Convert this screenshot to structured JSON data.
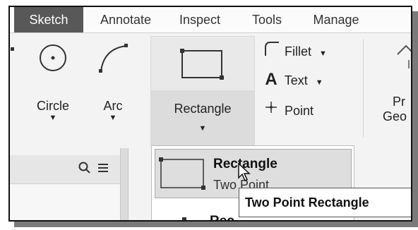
{
  "tabs": [
    {
      "label": "Sketch",
      "active": true
    },
    {
      "label": "Annotate",
      "active": false
    },
    {
      "label": "Inspect",
      "active": false
    },
    {
      "label": "Tools",
      "active": false
    },
    {
      "label": "Manage",
      "active": false
    }
  ],
  "ribbon": {
    "circle_label": "Circle",
    "arc_label": "Arc",
    "rectangle_label": "Rectangle",
    "fillet_label": "Fillet",
    "text_label": "Text",
    "point_label": "Point",
    "project_label": "Pr",
    "geometry_label": "Geo"
  },
  "panel": {
    "search_icon": "search-icon",
    "menu_icon": "menu-icon"
  },
  "dropdown": {
    "item1_title": "Rectangle",
    "item1_subtitle": "Two Point",
    "item2_title": "Rec"
  },
  "tooltip": "Two Point Rectangle",
  "colors": {
    "active_tab": "#585858",
    "ribbon_bg": "#f3f3f3"
  }
}
